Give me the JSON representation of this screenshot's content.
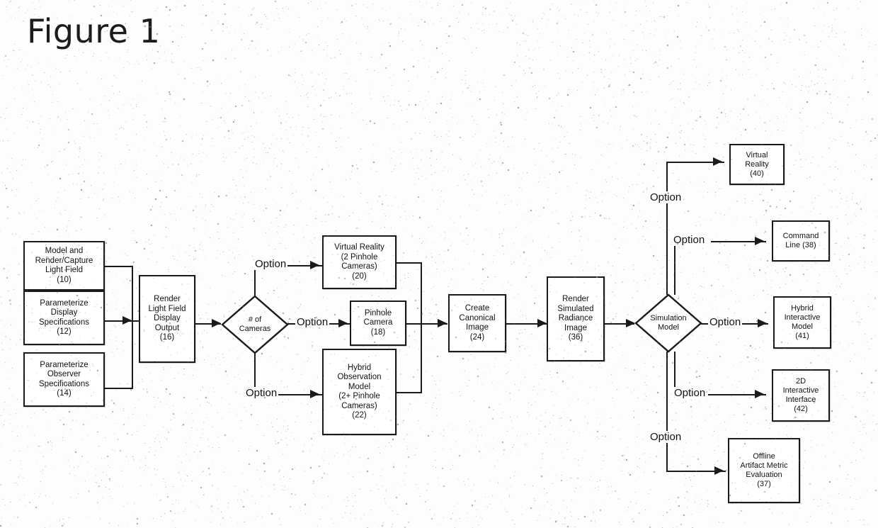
{
  "figure": {
    "title": "Figure 1"
  },
  "diagram": {
    "type": "flowchart",
    "nodes": [
      {
        "id": "10",
        "label": "Model and\nRender/Capture\nLight Field\n(10)",
        "lines": [
          "Model and",
          "Render/Capture",
          "Light Field",
          "(10)"
        ],
        "shape": "rect"
      },
      {
        "id": "12",
        "label": "Parameterize\nDisplay\nSpecifications\n(12)",
        "lines": [
          "Parameterize",
          "Display",
          "Specifications",
          "(12)"
        ],
        "shape": "rect"
      },
      {
        "id": "14",
        "label": "Parameterize\nObserver\nSpecifications\n(14)",
        "lines": [
          "Parameterize",
          "Observer",
          "Specifications",
          "(14)"
        ],
        "shape": "rect"
      },
      {
        "id": "16",
        "label": "Render\nLight Field\nDisplay\nOutput\n(16)",
        "lines": [
          "Render",
          "Light Field",
          "Display",
          "Output",
          "(16)"
        ],
        "shape": "rect"
      },
      {
        "id": "cameras",
        "label": "# of\nCameras",
        "lines": [
          "# of",
          "Cameras"
        ],
        "shape": "diamond"
      },
      {
        "id": "20",
        "label": "Virtual Reality\n(2 Pinhole\nCameras)\n(20)",
        "lines": [
          "Virtual Reality",
          "(2 Pinhole",
          "Cameras)",
          "(20)"
        ],
        "shape": "rect"
      },
      {
        "id": "18",
        "label": "Pinhole\nCamera\n(18)",
        "lines": [
          "Pinhole",
          "Camera",
          "(18)"
        ],
        "shape": "rect"
      },
      {
        "id": "22",
        "label": "Hybrid\nObservation\nModel\n(2+ Pinhole\nCameras)\n(22)",
        "lines": [
          "Hybrid",
          "Observation",
          "Model",
          "(2+ Pinhole",
          "Cameras)",
          "(22)"
        ],
        "shape": "rect"
      },
      {
        "id": "24",
        "label": "Create\nCanonical\nImage\n(24)",
        "lines": [
          "Create",
          "Canonical",
          "Image",
          "(24)"
        ],
        "shape": "rect"
      },
      {
        "id": "36",
        "label": "Render\nSimulated\nRadiance\nImage\n(36)",
        "lines": [
          "Render",
          "Simulated",
          "Radiance",
          "Image",
          "(36)"
        ],
        "shape": "rect"
      },
      {
        "id": "simmodel",
        "label": "Simulation\nModel",
        "lines": [
          "Simulation",
          "Model"
        ],
        "shape": "diamond"
      },
      {
        "id": "40",
        "label": "Virtual\nReality\n(40)",
        "lines": [
          "Virtual",
          "Reality",
          "(40)"
        ],
        "shape": "rect"
      },
      {
        "id": "38",
        "label": "Command\nLine (38)",
        "lines": [
          "Command",
          "Line (38)"
        ],
        "shape": "rect"
      },
      {
        "id": "41",
        "label": "Hybrid\nInteractive\nModel\n(41)",
        "lines": [
          "Hybrid",
          "Interactive",
          "Model",
          "(41)"
        ],
        "shape": "rect"
      },
      {
        "id": "42",
        "label": "2D\nInteractive\nInterface\n(42)",
        "lines": [
          "2D",
          "Interactive",
          "Interface",
          "(42)"
        ],
        "shape": "rect"
      },
      {
        "id": "37",
        "label": "Offline\nArtifact Metric\nEvaluation\n(37)",
        "lines": [
          "Offline",
          "Artifact Metric",
          "Evaluation",
          "(37)"
        ],
        "shape": "rect"
      }
    ],
    "edge_labels": {
      "cameras_to_20": "Option",
      "cameras_to_18": "Option",
      "cameras_to_22": "Option",
      "sim_to_40": "Option",
      "sim_to_38": "Option",
      "sim_to_41": "Option",
      "sim_to_42": "Option",
      "sim_to_37": "Option"
    },
    "edges": [
      {
        "from": "10",
        "to": "16"
      },
      {
        "from": "12",
        "to": "16"
      },
      {
        "from": "14",
        "to": "16"
      },
      {
        "from": "16",
        "to": "cameras"
      },
      {
        "from": "cameras",
        "to": "20",
        "label": "Option"
      },
      {
        "from": "cameras",
        "to": "18",
        "label": "Option"
      },
      {
        "from": "cameras",
        "to": "22",
        "label": "Option"
      },
      {
        "from": "20",
        "to": "24"
      },
      {
        "from": "18",
        "to": "24"
      },
      {
        "from": "22",
        "to": "24"
      },
      {
        "from": "24",
        "to": "36"
      },
      {
        "from": "36",
        "to": "simmodel"
      },
      {
        "from": "simmodel",
        "to": "40",
        "label": "Option"
      },
      {
        "from": "simmodel",
        "to": "38",
        "label": "Option"
      },
      {
        "from": "simmodel",
        "to": "41",
        "label": "Option"
      },
      {
        "from": "simmodel",
        "to": "42",
        "label": "Option"
      },
      {
        "from": "simmodel",
        "to": "37",
        "label": "Option"
      }
    ],
    "colors": {
      "ink": "#1a1a1a",
      "paper": "#fdfdfd"
    }
  }
}
